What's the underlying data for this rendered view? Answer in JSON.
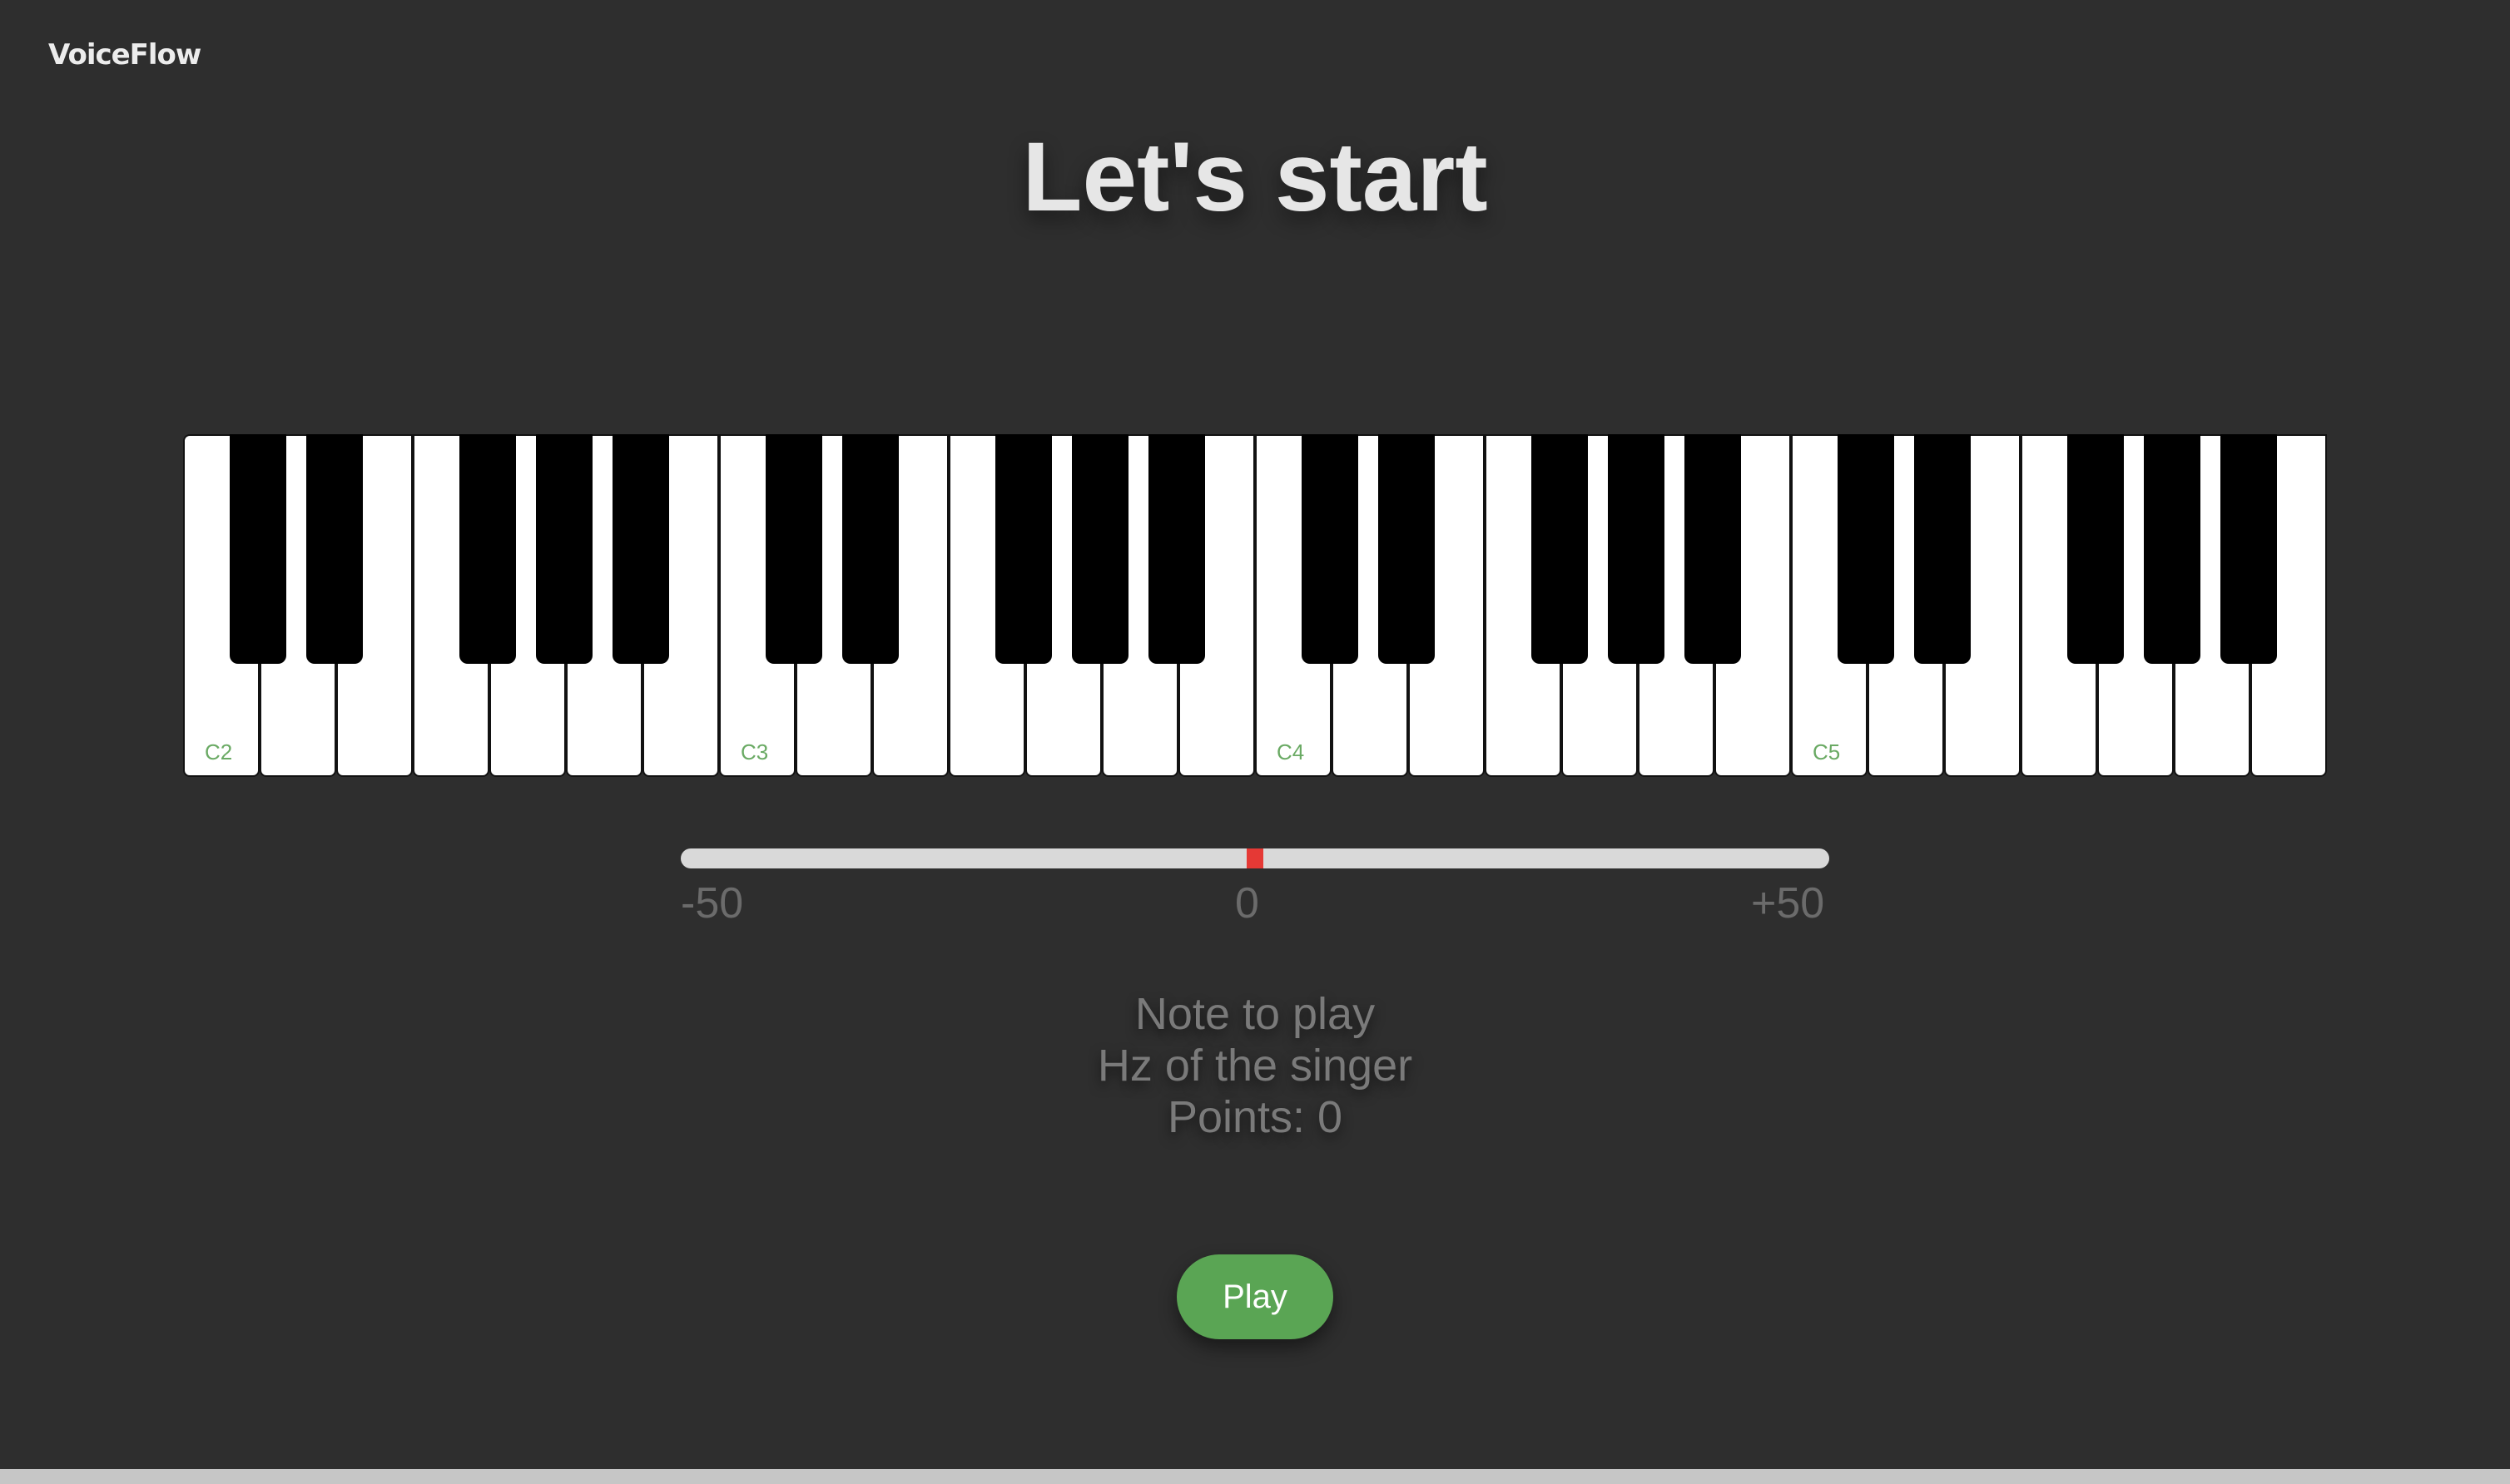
{
  "brand": "VoiceFlow",
  "title": "Let's start",
  "piano": {
    "white_key_count": 28,
    "octave_labels": [
      "C2",
      "C3",
      "C4",
      "C5"
    ],
    "label_color": "#6aaa64"
  },
  "tuner": {
    "min_label": "-50",
    "mid_label": "0",
    "max_label": "+50",
    "cents_deviation": 0,
    "marker_color": "#e53935"
  },
  "info": {
    "note_line": "Note to play",
    "hz_line": "Hz of the singer",
    "points_line": "Points: 0"
  },
  "actions": {
    "play_label": "Play",
    "play_color": "#5aa554"
  }
}
